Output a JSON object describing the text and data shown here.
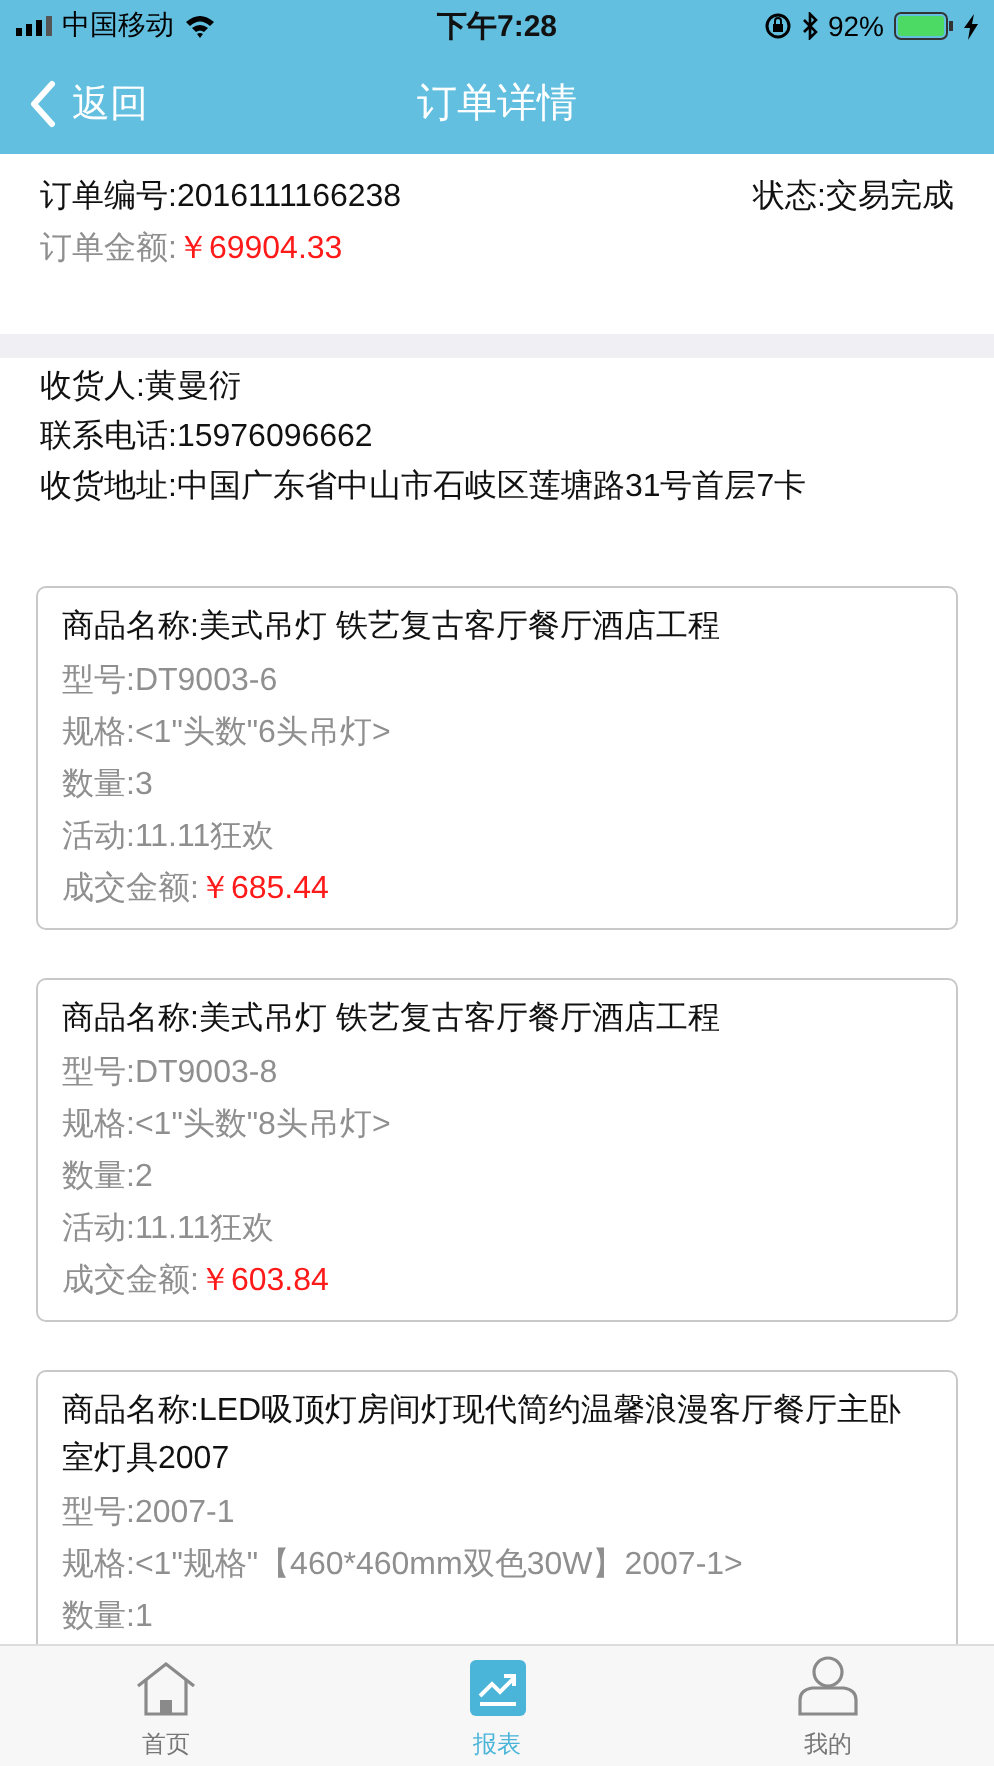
{
  "status_bar": {
    "carrier": "中国移动",
    "time": "下午7:28",
    "battery": "92%"
  },
  "nav": {
    "back": "返回",
    "title": "订单详情"
  },
  "order": {
    "number": "订单编号:2016111166238",
    "status": "状态:交易完成",
    "amount_label": "订单金额:",
    "amount": "￥69904.33"
  },
  "receiver": [
    "收货人:黄曼衍",
    "联系电话:15976096662",
    "收货地址:中国广东省中山市石岐区莲塘路31号首层7卡"
  ],
  "items": [
    {
      "name": "商品名称:美式吊灯 铁艺复古客厅餐厅酒店工程",
      "details": [
        "型号:DT9003-6",
        "规格:<1\"头数\"6头吊灯>",
        "数量:3",
        "活动:11.11狂欢"
      ],
      "price_label": "成交金额:",
      "price": "￥685.44"
    },
    {
      "name": "商品名称:美式吊灯 铁艺复古客厅餐厅酒店工程",
      "details": [
        "型号:DT9003-8",
        "规格:<1\"头数\"8头吊灯>",
        "数量:2",
        "活动:11.11狂欢"
      ],
      "price_label": "成交金额:",
      "price": "￥603.84"
    },
    {
      "name": "商品名称:LED吸顶灯房间灯现代简约温馨浪漫客厅餐厅主卧室灯具2007",
      "details": [
        "型号:2007-1",
        "规格:<1\"规格\"【460*460mm双色30W】2007-1>",
        "数量:1"
      ]
    }
  ],
  "tabs": [
    {
      "kind": "home",
      "label": "首页",
      "selected": false
    },
    {
      "kind": "chart",
      "label": "报表",
      "selected": true
    },
    {
      "kind": "person",
      "label": "我的",
      "selected": false
    }
  ]
}
